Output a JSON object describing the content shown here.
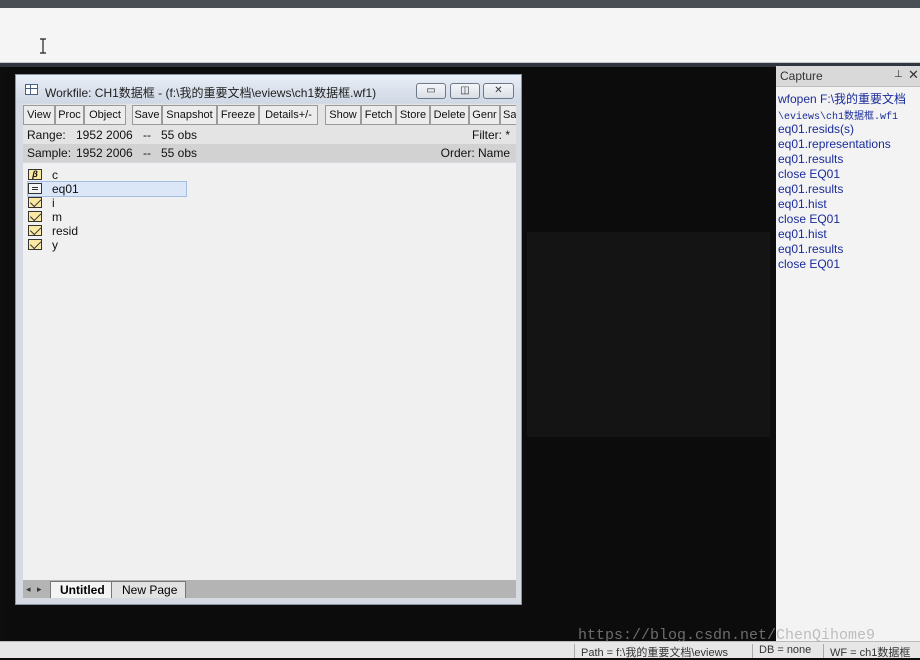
{
  "workfile": {
    "title": "Workfile: CH1数据框 - (f:\\我的重要文档\\eviews\\ch1数据框.wf1)",
    "window_buttons": {
      "minimize": "▭",
      "restore": "◫",
      "close": "✕"
    },
    "toolbar": [
      "View",
      "Proc",
      "Object",
      "Save",
      "Snapshot",
      "Freeze",
      "Details+/-",
      "Show",
      "Fetch",
      "Store",
      "Delete",
      "Genr",
      "Sa"
    ],
    "range_label": "Range:",
    "range_value": "1952 2006",
    "range_sep": "--",
    "range_obs": "55 obs",
    "filter": "Filter: *",
    "sample_label": "Sample:",
    "sample_value": "1952 2006",
    "sample_sep": "--",
    "sample_obs": "55 obs",
    "order": "Order: Name",
    "objects": [
      {
        "name": "c",
        "icon": "coefficient-icon"
      },
      {
        "name": "eq01",
        "icon": "equation-icon",
        "selected": true
      },
      {
        "name": "i",
        "icon": "series-icon"
      },
      {
        "name": "m",
        "icon": "series-icon"
      },
      {
        "name": "resid",
        "icon": "series-icon"
      },
      {
        "name": "y",
        "icon": "series-icon"
      }
    ],
    "tabs": {
      "active": "Untitled",
      "other": "New Page"
    }
  },
  "capture": {
    "title": "Capture",
    "lines": [
      "wfopen F:\\我的重要文档",
      "\\eviews\\ch1数据框.wf1",
      "eq01.resids(s)",
      "eq01.representations",
      "eq01.results",
      "close EQ01",
      "eq01.results",
      "eq01.hist",
      "close EQ01",
      "eq01.hist",
      "eq01.results",
      "close EQ01"
    ]
  },
  "status": {
    "path": "Path = f:\\我的重要文档\\eviews",
    "db": "DB = none",
    "wf": "WF = ch1数据框"
  },
  "watermark": "https://blog.csdn.net/ChenQihome9"
}
